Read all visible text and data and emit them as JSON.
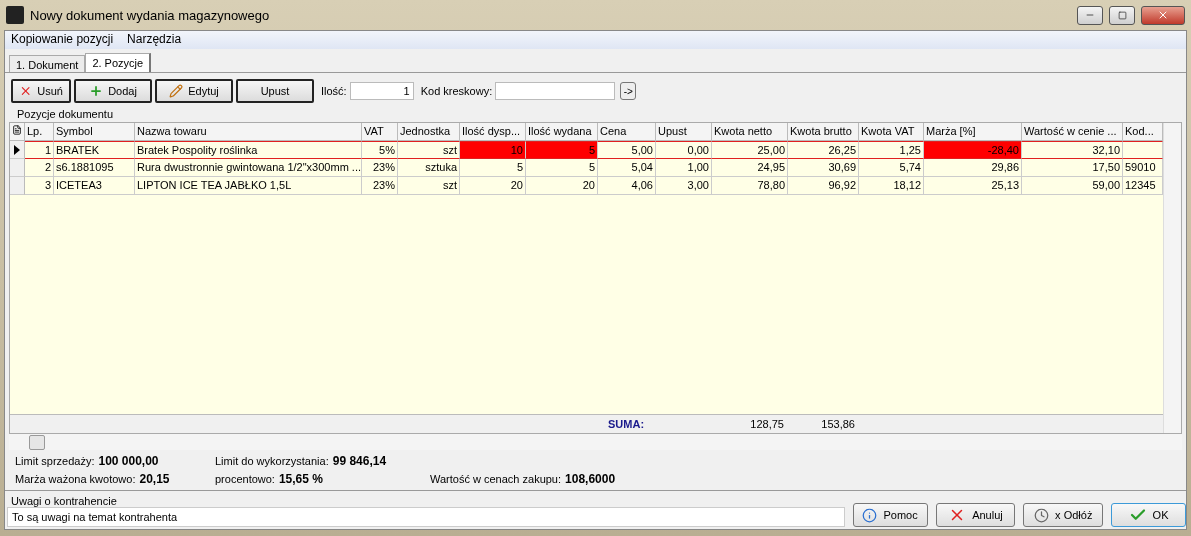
{
  "window": {
    "title": "Nowy dokument wydania magazynowego"
  },
  "menu": [
    "Kopiowanie pozycji",
    "Narzędzia"
  ],
  "tabs": [
    {
      "label": "1. Dokument",
      "selected": false
    },
    {
      "label": "2. Pozycje",
      "selected": true
    }
  ],
  "toolbar": {
    "buttons": [
      {
        "kind": "delete",
        "label": "Usuń"
      },
      {
        "kind": "add",
        "label": "Dodaj"
      },
      {
        "kind": "edit",
        "label": "Edytuj"
      },
      {
        "kind": "plain",
        "label": "Upust"
      }
    ],
    "quantity": {
      "label": "Ilość:",
      "value": "1"
    },
    "barcode": {
      "label": "Kod kreskowy:"
    },
    "go_button": "->"
  },
  "group_title": "Pozycje dokumentu",
  "table": {
    "columns": [
      "Lp.",
      "Symbol",
      "Nazwa towaru",
      "VAT",
      "Jednostka",
      "Ilość dysp...",
      "Ilość wydana",
      "Cena",
      "Upust",
      "Kwota netto",
      "Kwota brutto",
      "Kwota VAT",
      "Marża [%]",
      "Wartość w cenie ...",
      "Kod..."
    ],
    "rows": [
      {
        "selected": true,
        "cells": [
          {
            "text": "1",
            "alert": false
          },
          {
            "text": "BRATEK",
            "alert": false
          },
          {
            "text": "Bratek Pospolity roślinka",
            "alert": false
          },
          {
            "text": "5%",
            "alert": false
          },
          {
            "text": "szt",
            "alert": false
          },
          {
            "text": "10",
            "alert": true
          },
          {
            "text": "5",
            "alert": true
          },
          {
            "text": "5,00",
            "alert": false
          },
          {
            "text": "0,00",
            "alert": false
          },
          {
            "text": "25,00",
            "alert": false
          },
          {
            "text": "26,25",
            "alert": false
          },
          {
            "text": "1,25",
            "alert": false
          },
          {
            "text": "-28,40",
            "alert": true
          },
          {
            "text": "32,10",
            "alert": false
          },
          {
            "text": "",
            "alert": false
          }
        ]
      },
      {
        "selected": false,
        "cells": [
          {
            "text": "2",
            "alert": false
          },
          {
            "text": "s6.1881095",
            "alert": false
          },
          {
            "text": "Rura dwustronnie gwintowana 1/2\"x300mm ...",
            "alert": false
          },
          {
            "text": "23%",
            "alert": false
          },
          {
            "text": "sztuka",
            "alert": false
          },
          {
            "text": "5",
            "alert": false
          },
          {
            "text": "5",
            "alert": false
          },
          {
            "text": "5,04",
            "alert": false
          },
          {
            "text": "1,00",
            "alert": false
          },
          {
            "text": "24,95",
            "alert": false
          },
          {
            "text": "30,69",
            "alert": false
          },
          {
            "text": "5,74",
            "alert": false
          },
          {
            "text": "29,86",
            "alert": false
          },
          {
            "text": "17,50",
            "alert": false
          },
          {
            "text": "59010",
            "alert": false
          }
        ]
      },
      {
        "selected": false,
        "cells": [
          {
            "text": "3",
            "alert": false
          },
          {
            "text": "ICETEA3",
            "alert": false
          },
          {
            "text": "LIPTON ICE TEA JABŁKO 1,5L",
            "alert": false
          },
          {
            "text": "23%",
            "alert": false
          },
          {
            "text": "szt",
            "alert": false
          },
          {
            "text": "20",
            "alert": false
          },
          {
            "text": "20",
            "alert": false
          },
          {
            "text": "4,06",
            "alert": false
          },
          {
            "text": "3,00",
            "alert": false
          },
          {
            "text": "78,80",
            "alert": false
          },
          {
            "text": "96,92",
            "alert": false
          },
          {
            "text": "18,12",
            "alert": false
          },
          {
            "text": "25,13",
            "alert": false
          },
          {
            "text": "59,00",
            "alert": false
          },
          {
            "text": "12345",
            "alert": false
          }
        ]
      }
    ],
    "summary": {
      "label": "SUMA:",
      "netto": "128,75",
      "brutto": "153,86"
    }
  },
  "info": [
    {
      "label": "Limit sprzedaży:",
      "value": "100 000,00"
    },
    {
      "label": "Limit do wykorzystania:",
      "value": "99 846,14"
    },
    {
      "label": "Marża ważona kwotowo:",
      "value": "20,15"
    },
    {
      "label": "procentowo:",
      "value": "15,65 %"
    },
    {
      "label": "Wartość w cenach zakupu:",
      "value": "108,6000"
    }
  ],
  "notes": {
    "label": "Uwagi o kontrahencie",
    "value": "To są uwagi na temat kontrahenta"
  },
  "footer_buttons": [
    {
      "kind": "help",
      "label": "Pomoc"
    },
    {
      "kind": "cancel",
      "label": "Anuluj"
    },
    {
      "kind": "postpone",
      "label": "x Odłóż"
    },
    {
      "kind": "ok",
      "label": "OK"
    }
  ]
}
